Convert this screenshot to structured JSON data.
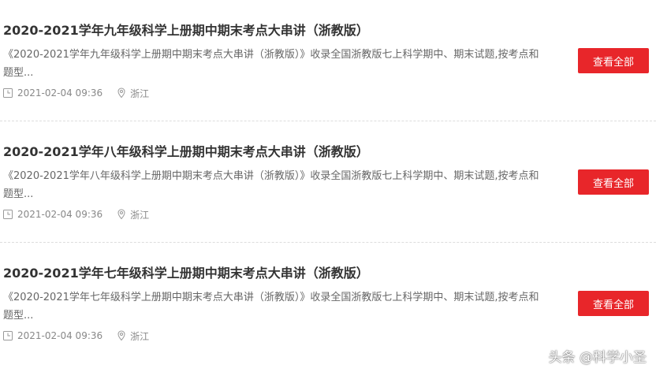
{
  "articles": [
    {
      "title": "2020-2021学年九年级科学上册期中期末考点大串讲（浙教版）",
      "description": "《2020-2021学年九年级科学上册期中期末考点大串讲（浙教版）》收录全国浙教版七上科学期中、期末试题,按考点和题型...",
      "date": "2021-02-04 09:36",
      "location": "浙江",
      "button_label": "查看全部"
    },
    {
      "title": "2020-2021学年八年级科学上册期中期末考点大串讲（浙教版）",
      "description": "《2020-2021学年八年级科学上册期中期末考点大串讲（浙教版）》收录全国浙教版七上科学期中、期末试题,按考点和题型...",
      "date": "2021-02-04 09:36",
      "location": "浙江",
      "button_label": "查看全部"
    },
    {
      "title": "2020-2021学年七年级科学上册期中期末考点大串讲（浙教版）",
      "description": "《2020-2021学年七年级科学上册期中期末考点大串讲（浙教版）》收录全国浙教版七上科学期中、期末试题,按考点和题型...",
      "date": "2021-02-04 09:36",
      "location": "浙江",
      "button_label": "查看全部"
    }
  ],
  "watermark": "头条 @科学小圣",
  "colors": {
    "button": "#e8262a",
    "title": "#333333",
    "description": "#666666",
    "meta": "#888888"
  },
  "icons": {
    "time": "clock-icon",
    "place": "location-pin-icon"
  }
}
